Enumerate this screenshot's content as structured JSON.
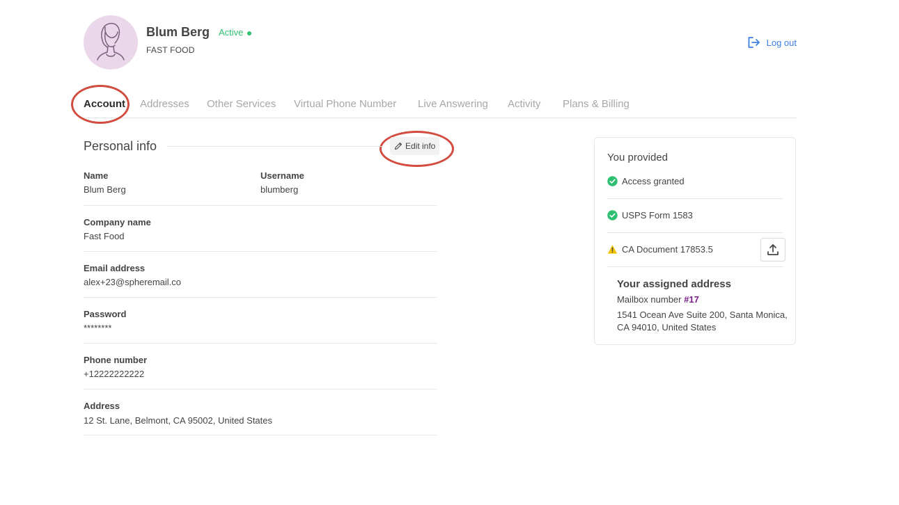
{
  "profile": {
    "name": "Blum Berg",
    "status": "Active",
    "company": "FAST FOOD",
    "status_color": "#2fbf71",
    "avatar_bg": "#ead8ea"
  },
  "header": {
    "logout_label": "Log out",
    "logout_icon": "logout-icon",
    "accent_color": "#3d7ee0"
  },
  "tabs": [
    {
      "label": "Account",
      "active": true
    },
    {
      "label": "Addresses",
      "active": false
    },
    {
      "label": "Other Services",
      "active": false
    },
    {
      "label": "Virtual Phone Number",
      "active": false
    },
    {
      "label": "Live Answering",
      "active": false
    },
    {
      "label": "Activity",
      "active": false
    },
    {
      "label": "Plans & Billing",
      "active": false
    }
  ],
  "personal_info": {
    "title": "Personal info",
    "edit_label": "Edit info",
    "fields": {
      "name": {
        "label": "Name",
        "value": "Blum Berg"
      },
      "username": {
        "label": "Username",
        "value": "blumberg"
      },
      "company": {
        "label": "Company name",
        "value": "Fast Food"
      },
      "email": {
        "label": "Email address",
        "value": "alex+23@spheremail.co"
      },
      "password": {
        "label": "Password",
        "value": "********"
      },
      "phone": {
        "label": "Phone number",
        "value": "+12222222222"
      },
      "address": {
        "label": "Address",
        "value": "12 St. Lane, Belmont, CA 95002, United States"
      }
    }
  },
  "provided": {
    "title": "You provided",
    "items": [
      {
        "label": "Access granted",
        "status": "ok"
      },
      {
        "label": "USPS Form 1583",
        "status": "ok"
      },
      {
        "label": "CA Document 17853.5",
        "status": "warning"
      }
    ],
    "ok_color": "#2fbf71",
    "warning_color": "#f2c200"
  },
  "assigned": {
    "title": "Your assigned address",
    "mailbox_label": "Mailbox number",
    "mailbox_number": "#17",
    "address": "1541 Ocean Ave Suite 200, Santa Monica, CA 94010, United States"
  },
  "annotations": {
    "highlight_color": "#d24c3f"
  }
}
